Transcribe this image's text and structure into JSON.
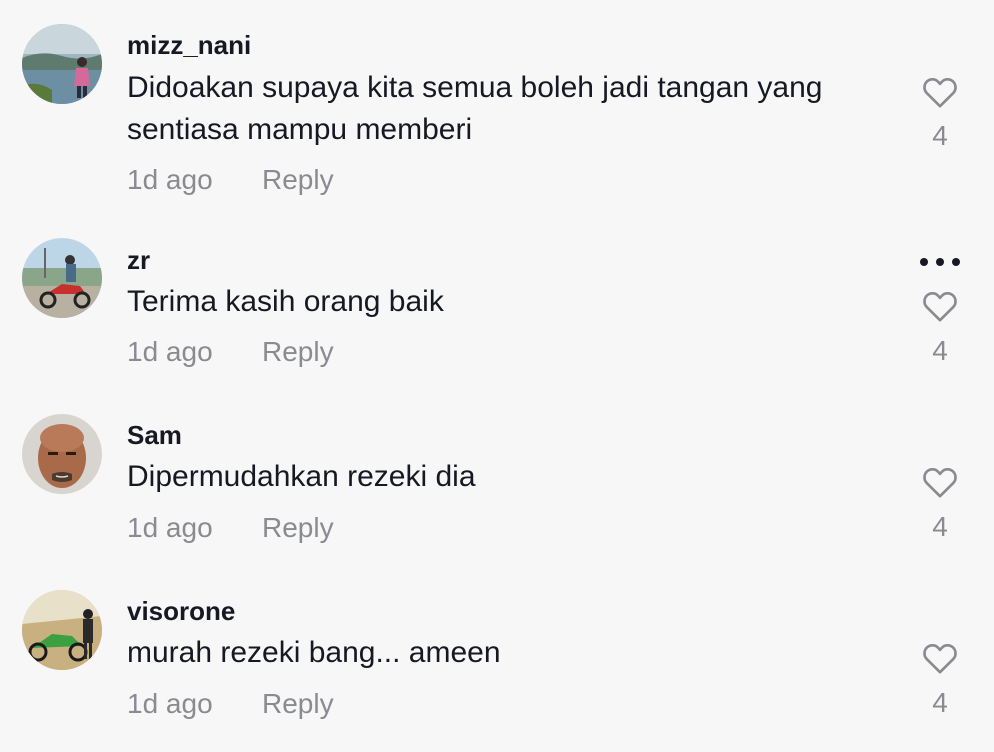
{
  "comments": [
    {
      "username": "mizz_nani",
      "text": "Didoakan supaya kita semua boleh jadi tangan yang sentiasa mampu memberi",
      "time": "1d ago",
      "reply": "Reply",
      "likes": "4",
      "avatar": "avatar-lakeside-woman"
    },
    {
      "username": "zr",
      "text": "Terima kasih orang baik",
      "time": "1d ago",
      "reply": "Reply",
      "likes": "4",
      "avatar": "avatar-motorcycle-rider",
      "more_icon": "more-icon"
    },
    {
      "username": "Sam",
      "text": "Dipermudahkan rezeki dia",
      "time": "1d ago",
      "reply": "Reply",
      "likes": "4",
      "avatar": "avatar-man-face"
    },
    {
      "username": "visorone",
      "text": "murah rezeki bang... ameen",
      "time": "1d ago",
      "reply": "Reply",
      "likes": "4",
      "avatar": "avatar-green-motorcycle"
    }
  ],
  "colors": {
    "background": "#f7f7f7",
    "primary_text": "#161823",
    "secondary_text": "#8a8b91",
    "icon": "#8a8b91"
  }
}
